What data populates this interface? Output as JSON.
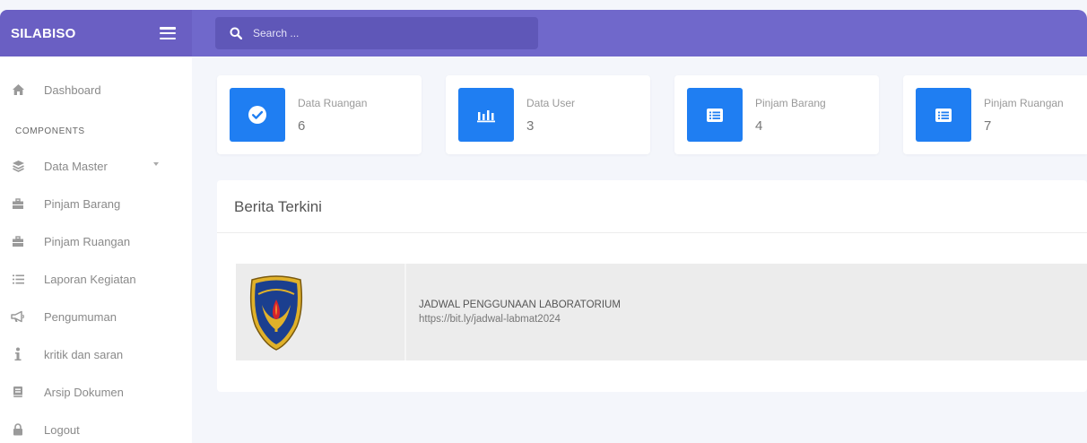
{
  "brand": {
    "name": "SILABISO"
  },
  "search": {
    "placeholder": "Search ..."
  },
  "sidebar": {
    "items": [
      {
        "label": "Dashboard",
        "icon": "home-icon"
      },
      {
        "label": "Data Master",
        "icon": "layers-icon",
        "has_caret": true
      },
      {
        "label": "Pinjam Barang",
        "icon": "briefcase-icon"
      },
      {
        "label": "Pinjam Ruangan",
        "icon": "briefcase-icon"
      },
      {
        "label": "Laporan Kegiatan",
        "icon": "list-icon"
      },
      {
        "label": "Pengumuman",
        "icon": "megaphone-icon"
      },
      {
        "label": "kritik dan saran",
        "icon": "info-icon"
      },
      {
        "label": "Arsip Dokumen",
        "icon": "book-icon"
      },
      {
        "label": "Logout",
        "icon": "lock-icon"
      }
    ],
    "section_label": "COMPONENTS"
  },
  "stats": [
    {
      "label": "Data Ruangan",
      "value": "6",
      "icon": "check-circle-icon"
    },
    {
      "label": "Data User",
      "value": "3",
      "icon": "bar-chart-icon"
    },
    {
      "label": "Pinjam Barang",
      "value": "4",
      "icon": "list-alt-icon"
    },
    {
      "label": "Pinjam Ruangan",
      "value": "7",
      "icon": "list-alt-icon"
    }
  ],
  "news": {
    "title": "Berita Terkini",
    "items": [
      {
        "title": "JADWAL PENGGUNAAN LABORATORIUM",
        "link": "https://bit.ly/jadwal-labmat2024",
        "image": "university-emblem"
      }
    ]
  },
  "colors": {
    "sidebar_header": "#6a5fc3",
    "navbar": "#7068cb",
    "accent_tile": "#1f7ef2",
    "background": "#f4f6fb"
  }
}
